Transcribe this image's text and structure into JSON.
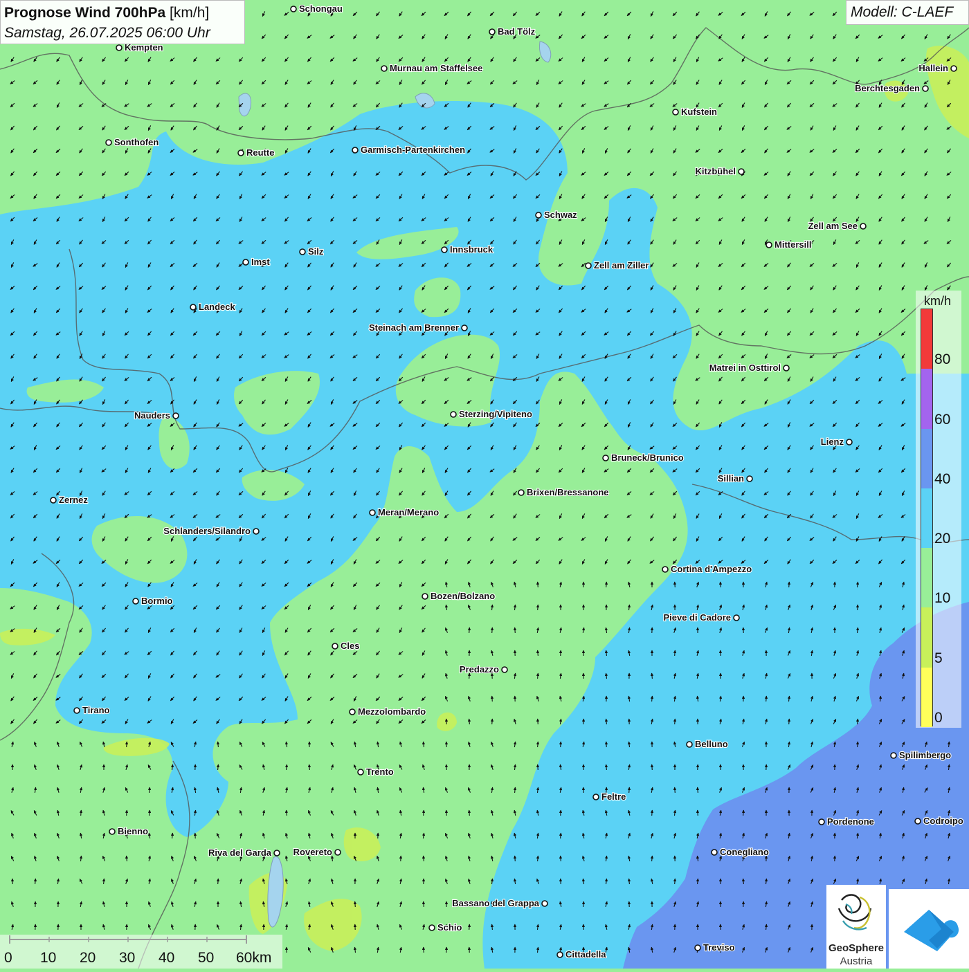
{
  "title": {
    "main": "Prognose Wind 700hPa",
    "unit": "[km/h]",
    "datetime": "Samstag, 26.07.2025 06:00 Uhr"
  },
  "model_label": "Modell: C-LAEF",
  "legend": {
    "unit": "km/h",
    "classes": [
      {
        "label": "0",
        "color": "#ffff5a"
      },
      {
        "label": "5",
        "color": "#c8f05a"
      },
      {
        "label": "10",
        "color": "#98ee98"
      },
      {
        "label": "20",
        "color": "#5bd2f5"
      },
      {
        "label": "40",
        "color": "#6a96f0"
      },
      {
        "label": "60",
        "color": "#a364ee"
      },
      {
        "label": "80",
        "color": "#f23a3a"
      }
    ]
  },
  "scalebar": {
    "labels": [
      "0",
      "10",
      "20",
      "30",
      "40",
      "50",
      "60km"
    ]
  },
  "cities": [
    {
      "name": "Schongau"
    },
    {
      "name": "Bad Tölz"
    },
    {
      "name": "Kempten"
    },
    {
      "name": "Murnau am Staffelsee"
    },
    {
      "name": "Hallein"
    },
    {
      "name": "Berchtesgaden"
    },
    {
      "name": "Kufstein"
    },
    {
      "name": "Sonthofen"
    },
    {
      "name": "Reutte"
    },
    {
      "name": "Garmisch-Partenkirchen"
    },
    {
      "name": "Kitzbühel"
    },
    {
      "name": "Schwaz"
    },
    {
      "name": "Zell am See"
    },
    {
      "name": "Mittersill"
    },
    {
      "name": "Innsbruck"
    },
    {
      "name": "Silz"
    },
    {
      "name": "Imst"
    },
    {
      "name": "Zell am Ziller"
    },
    {
      "name": "Landeck"
    },
    {
      "name": "Steinach am Brenner"
    },
    {
      "name": "Matrei in Osttirol"
    },
    {
      "name": "Nauders"
    },
    {
      "name": "Sterzing/Vipiteno"
    },
    {
      "name": "Lienz"
    },
    {
      "name": "Bruneck/Brunico"
    },
    {
      "name": "Sillian"
    },
    {
      "name": "Zernez"
    },
    {
      "name": "Brixen/Bressanone"
    },
    {
      "name": "Meran/Merano"
    },
    {
      "name": "Schlanders/Silandro"
    },
    {
      "name": "Cortina d'Ampezzo"
    },
    {
      "name": "Bozen/Bolzano"
    },
    {
      "name": "Bormio"
    },
    {
      "name": "Pieve di Cadore"
    },
    {
      "name": "Cles"
    },
    {
      "name": "Predazzo"
    },
    {
      "name": "Tirano"
    },
    {
      "name": "Mezzolombardo"
    },
    {
      "name": "Belluno"
    },
    {
      "name": "Spilimbergo"
    },
    {
      "name": "Trento"
    },
    {
      "name": "Feltre"
    },
    {
      "name": "Bienno"
    },
    {
      "name": "Pordenone"
    },
    {
      "name": "Codroipo"
    },
    {
      "name": "Riva del Garda"
    },
    {
      "name": "Rovereto"
    },
    {
      "name": "Conegliano"
    },
    {
      "name": "Bassano del Grappa"
    },
    {
      "name": "Schio"
    },
    {
      "name": "Treviso"
    },
    {
      "name": "Cittadella"
    }
  ],
  "logos": {
    "geosphere_line1": "GeoSphere",
    "geosphere_line2": "Austria"
  }
}
